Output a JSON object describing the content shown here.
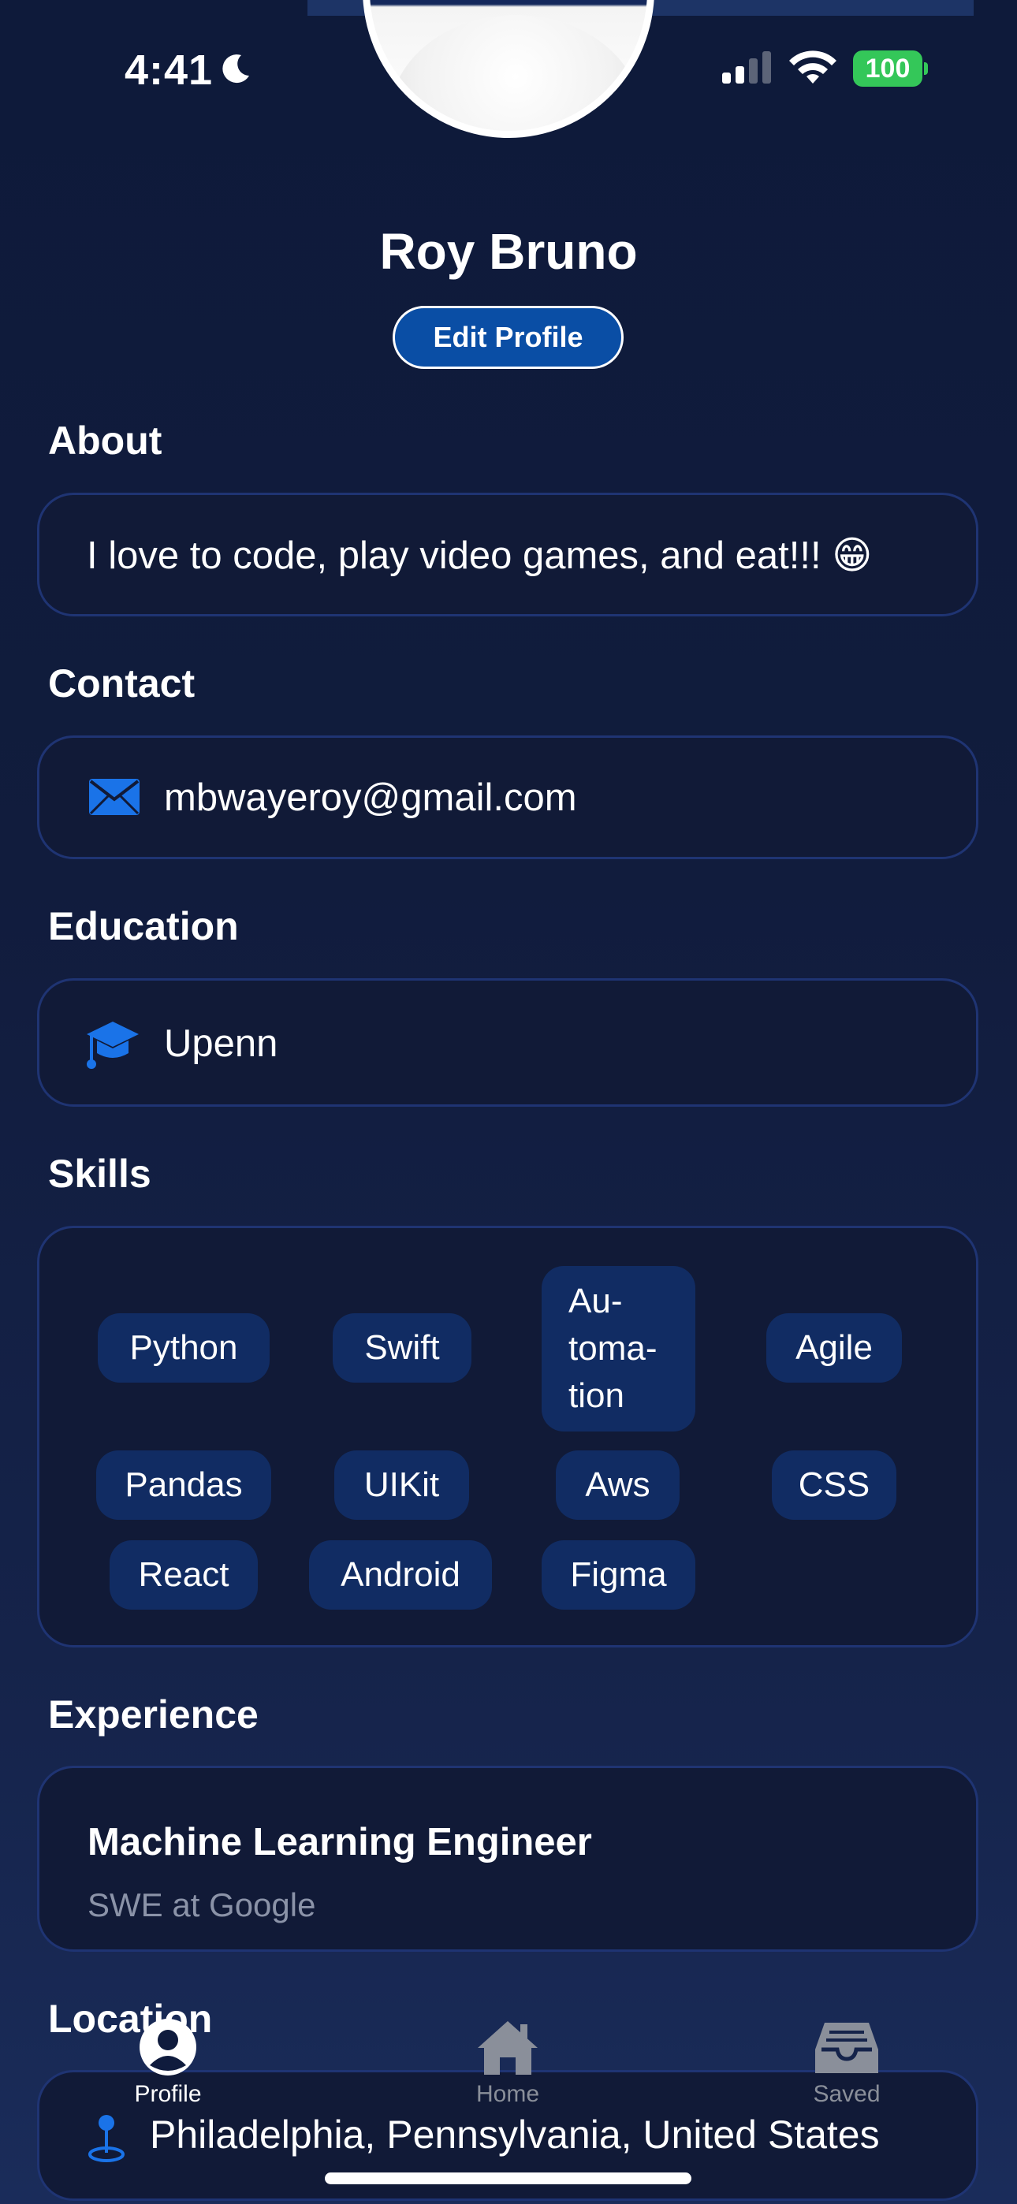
{
  "status_bar": {
    "time": "4:41",
    "battery": "100"
  },
  "profile": {
    "name": "Roy Bruno",
    "edit_button": "Edit Profile"
  },
  "about": {
    "title": "About",
    "text": "I love to code, play video games, and eat!!! 😁"
  },
  "contact": {
    "title": "Contact",
    "email": "mbwayeroy@gmail.com",
    "icon": "envelope-icon"
  },
  "education": {
    "title": "Education",
    "school": "Upenn",
    "icon": "graduation-cap-icon"
  },
  "skills": {
    "title": "Skills",
    "items": [
      "Python",
      "Swift",
      "Au-\ntoma-\ntion",
      "Agile",
      "Pandas",
      "UIKit",
      "Aws",
      "CSS",
      "React",
      "Android",
      "Figma"
    ]
  },
  "experience": {
    "title": "Experience",
    "role": "Machine Learning Engineer",
    "company": "SWE at Google"
  },
  "location": {
    "title": "Location",
    "place": "Philadelphia, Pennsylvania, United States",
    "icon": "map-pin-icon"
  },
  "tabbar": {
    "items": [
      {
        "label": "Profile",
        "icon": "person-circle-icon",
        "active": true
      },
      {
        "label": "Home",
        "icon": "house-icon",
        "active": false
      },
      {
        "label": "Saved",
        "icon": "tray-icon",
        "active": false
      }
    ]
  },
  "colors": {
    "accent": "#0a4ea5",
    "icon_blue": "#1a73e8",
    "chip_bg": "#112c63",
    "card_bg": "#111a37",
    "battery": "#34c759"
  }
}
